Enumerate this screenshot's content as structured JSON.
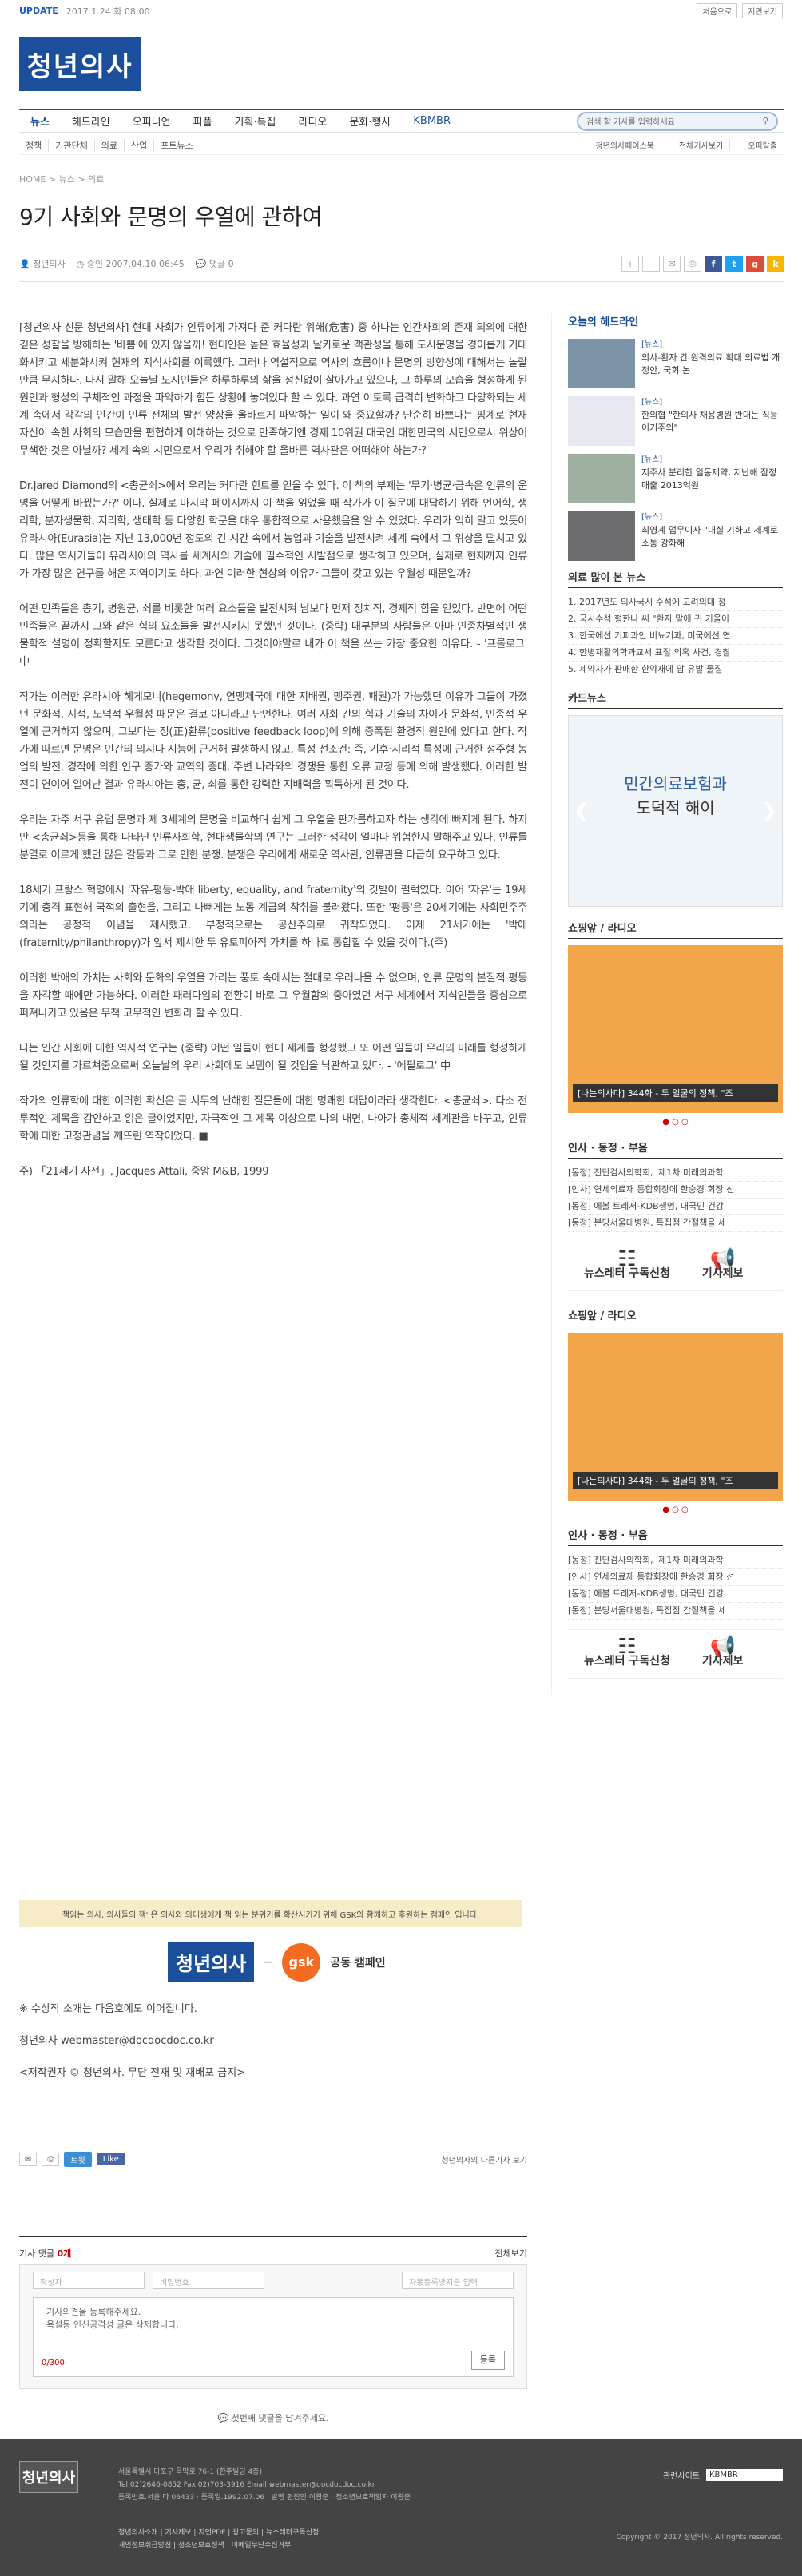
{
  "topbar": {
    "update": "UPDATE",
    "datetime": "2017.1.24 화 08:00",
    "links": [
      "처음으로",
      "지면보기"
    ]
  },
  "site": {
    "logo": "청년의사"
  },
  "nav": {
    "items": [
      "뉴스",
      "헤드라인",
      "오피니언",
      "피플",
      "기획·특집",
      "라디오",
      "문화·행사",
      "KBMBR"
    ],
    "search_placeholder": "검색 할 기사를 입력하세요"
  },
  "subnav": {
    "items": [
      "정책",
      "기관단체",
      "의료",
      "산업",
      "포토뉴스"
    ],
    "right": [
      "청년의사페이스북",
      "전체기사보기",
      "오피탈출"
    ]
  },
  "breadcrumb": "HOME  >  뉴스  >  의료",
  "article": {
    "title": "9기 사회와 문명의 우열에 관하여",
    "author": "청년의사",
    "date": "승인 2007.04.10 06:45",
    "comments": "댓글 0",
    "paragraphs": [
      "[청년의사 신문 청년의사] 현대 사회가 인류에게 가져다 준 커다란 위해(危害) 중 하나는 인간사회의 존재 의의에 대한 깊은 성찰을 방해하는 '바쁨'에 있지 않을까! 현대인은 높은 효율성과 날카로운 객관성을 통해 도시문명을 경이롭게 거대화시키고 세분화시켜 현재의 지식사회를 이룩했다. 그러나 역설적으로 역사의 흐름이나 문명의 방향성에 대해서는 놀랄 만큼 무지하다. 다시 말해 오늘날 도시인들은 하루하루의 삶을 정신없이 살아가고 있으나, 그 하루의 모습을 형성하게 된 원인과 형성의 구체적인 과정을 파악하기 힘든 상황에 놓여있다 할 수 있다. 과연 이토록 급격히 변화하고 다양화되는 세계 속에서 각각의 인간이 인류 전체의 발전 양상을 올바르게 파악하는 일이 왜 중요할까? 단순히 바쁘다는 핑계로 현재 자신이 속한 사회의 모습만을 편협하게 이해하는 것으로 만족하기엔 경제 10위권 대국인 대한민국의 시민으로서 위상이 무색한 것은 아닐까? 세계 속의 시민으로서 우리가 취해야 할 올바른 역사관은 어떠해야 하는가?",
      "Dr.Jared Diamond의 <총균쇠>에서 우리는 커다란 힌트를 얻을 수 있다. 이 책의 부제는 '무기·병균·금속은 인류의 운명을 어떻게 바꿨는가?' 이다. 실제로 마지막 페이지까지 이 책을 읽었을 때 작가가 이 질문에 대답하기 위해 언어학, 생리학, 분자생물학, 지리학, 생태학 등 다양한 학문을 매우 통합적으로 사용했음을 알 수 있었다. 우리가 익히 알고 있듯이 유라시아(Eurasia)는 지난 13,000년 정도의 긴 시간 속에서 농업과 기술을 발전시켜 세계 속에서 그 위상을 떨치고 있다. 많은 역사가들이 유라시아의 역사를 세계사의 기술에 필수적인 시발점으로 생각하고 있으며, 실제로 현재까지 인류가 가장 많은 연구를 해온 지역이기도 하다. 과연 이러한 현상의 이유가 그들이 갖고 있는 우월성 때문일까?",
      "어떤 민족들은 총기, 병원균, 쇠를 비롯한 여러 요소들을 발전시켜 남보다 먼저 정치적, 경제적 힘을 얻었다. 반면에 어떤 민족들은 끝까지 그와 같은 힘의 요소들을 발전시키지 못했던 것이다. (중략) 대부분의 사람들은 아마 인종차별적인 생물학적 설명이 정확할지도 모른다고 생각할 것이다. 그것이야말로 내가 이 책을 쓰는 가장 중요한 이유다. - '프롤로그' 中",
      "작가는 이러한 유라시아 헤게모니(hegemony, 연맹제국에 대한 지배권, 맹주권, 패권)가 가능했던 이유가 그들이 가졌던 문화적, 지적, 도덕적 우월성 때문은 결코 아니라고 단언한다. 여러 사회 간의 힘과 기술의 차이가 문화적, 인종적 우열에 근거하지 않으며, 그보다는 정(正)환류(positive feedback loop)에 의해 증폭된 환경적 원인에 있다고 한다. 작가에 따르면 문명은 인간의 의지나 지능에 근거해 발생하지 않고, 특정 선조건: 즉, 기후·지리적 특성에 근거한 정주형 농업의 발전, 경작에 의한 인구 증가와 교역의 증대, 주변 나라와의 경쟁을 통한 오류 교정 등에 의해 발생했다. 이러한 발전이 연이어 일어난 결과 유라시아는 총, 균, 쇠를 통한 강력한 지배력을 획득하게 된 것이다.",
      "우리는 자주 서구 유럽 문명과 제 3세계의 문명을 비교하며 쉽게 그 우열을 판가름하고자 하는 생각에 빠지게 된다. 하지만 <총균쇠>등을 통해 나타난 인류사회학, 현대생물학의 연구는 그러한 생각이 얼마나 위험한지 말해주고 있다. 인류를 분열로 이르게 했던 많은 갈등과 그로 인한 분쟁. 분쟁은 우리에게 새로운 역사관, 인류관을 다급히 요구하고 있다.",
      "18세기 프랑스 혁명에서 '자유-평등-박애 liberty, equality, and fraternity'의 깃발이 펄럭였다. 이어 '자유'는 19세기에 충격 표현해 국적의 출현을, 그리고 나뻐게는 노동 계급의 착취를 불러왔다. 또한 '평등'은 20세기에는 사회민주주의라는 공정적 이념을 제시했고, 부정적으로는 공산주의로 귀착되었다. 이제 21세기에는 '박애(fraternity/philanthropy)가 앞서 제시한 두 유토피아적 가치를 하나로 통합할 수 있을 것이다.(주)",
      "이러한 박애의 가치는 사회와 문화의 우열을 가리는 풍토 속에서는 절대로 우러나올 수 없으며, 인류 문명의 본질적 평등을 자각할 때에만 가능하다. 이러한 패러다임의 전환이 바로 그 우월함의 중아였던 서구 세계에서 지식인들을 중심으로 퍼져나가고 있음은 무척 고무적인 변화라 할 수 있다.",
      "나는 인간 사회에 대한 역사적 연구는 (중략) 어떤 일들이 현대 세계를 형성했고 또 어떤 일들이 우리의 미래를 형성하게 될 것인지를 가르쳐줌으로써 오늘날의 우리 사회에도 보탬이 될 것임을 낙관하고 있다. - '에필로그' 中",
      "작가의 인류학에 대한 이러한 확신은 글 서두의 난해한 질문들에 대한 명쾌한 대답이라라 생각한다. <총균쇠>. 다소 전투적인 제목을 감안하고 읽은 글이었지만, 자극적인 그 제목 이상으로 나의 내면, 나아가 총체적 세계관을 바꾸고, 인류학에 대한 고정관념을 깨뜨린 역작이었다. ■",
      "주) 「21세기 사전」, Jacques Attali, 중앙 M&B, 1999"
    ],
    "campaign_text": "책읽는 의사, 의사들의 책' 은 의사와 의대생에게 책 읽는 분위기를 확산시키기 위해 GSK와 함께하고 후원하는 캠페인 입니다.",
    "campaign": {
      "logo": "청년의사",
      "partner": "gsk",
      "label": "공동 캠페인"
    },
    "after": [
      "※ 수상작 소개는 다음호에도 이어집니다.",
      "청년의사   webmaster@docdocdoc.co.kr",
      "<저작권자 © 청년의사. 무단 전재 및 재배포 금지>"
    ],
    "share": {
      "tweet": "트윗",
      "like": "Like",
      "more": "청년의사의 다른기사 보기"
    }
  },
  "sidebar": {
    "headline_title": "오늘의 헤드라인",
    "headlines": [
      {
        "cat": "[뉴스]",
        "text": "의사-환자 간 원격의료 확대 의료법 개정안, 국회 논"
      },
      {
        "cat": "[뉴스]",
        "text": "한의협 \"한의사 채용병원 반대는 직능이기주의\""
      },
      {
        "cat": "[뉴스]",
        "text": "지주사 분리한 일동제약, 지난해 잠정매출 2013억원"
      },
      {
        "cat": "[뉴스]",
        "text": "최영계 업무이사 \"내실 기하고 세계로 소통 강화해"
      }
    ],
    "most_title": "의료 많이 본 뉴스",
    "most": [
      "1. 2017년도 의사국시 수석에 고려의대 정",
      "2. 국시수석 형한나 씨 \"환자 말에 귀 기울이",
      "3. 한국에선 기피과인 비뇨기과, 미국에선 연",
      "4. 한병재활의학과교서 표절 의혹 사건, 경찰",
      "5. 제약사가 판매한 한약재에 암 유발 물질"
    ],
    "card_title": "카드뉴스",
    "card_line1": "민간의료보험과",
    "card_line2": "도덕적 해이",
    "shop_title": "쇼핑앞 / 라디오",
    "shop_caption": "[나는의사다] 344화 - 두 얼굴의 정책, \"조",
    "people_title": "인사 · 동정 · 부음",
    "people": [
      "[동정] 진단검사의학회, '제1차 미래의과학",
      "[인사] 연세의료재 통합회장에 한승경 회장 선",
      "[동정] 에볼 트레저-KDB생명, 대국민 건강",
      "[동정] 분당서울대병원, 특집점 간절책을 세"
    ],
    "newsletter": "뉴스레터 구독신청",
    "report": "기사제보"
  },
  "comments": {
    "title": "기사 댓글",
    "count": "0개",
    "all": "전체보기",
    "name": "작성자",
    "pw": "비밀번호",
    "anti": "자동등록방지글 입력",
    "body": "기사의견을 등록해주세요.\n욕설등 인신공격성 글은 삭제합니다.",
    "counter": "0/300",
    "submit": "등록",
    "first": "첫번째 댓글을 남겨주세요."
  },
  "footer": {
    "logo": "청년의사",
    "address": "서울특별시 마포구 독막로 76-1 (한주빌딩 4층)",
    "tel": "Tel.02)2646-0852   Fax.02)703-3916   Email.webmaster@docdocdoc.co.kr",
    "reg": "등록번호.서울 다 06433 · 등록일.1992.07.06 · 발행 편집인 이왕준 · 청소년보호책임자 이왕준",
    "select_label": "관련사이트",
    "select_value": "KBMBR",
    "links": "청년의사소개 | 기사제보 | 지면PDF | 광고문의 | 뉴스레터구독신청",
    "links2": "개인정보취급방침 | 청소년보호정책 | 이메일무단수집거부",
    "copyright": "Copyright © 2017 청년의사. All rights reserved."
  }
}
